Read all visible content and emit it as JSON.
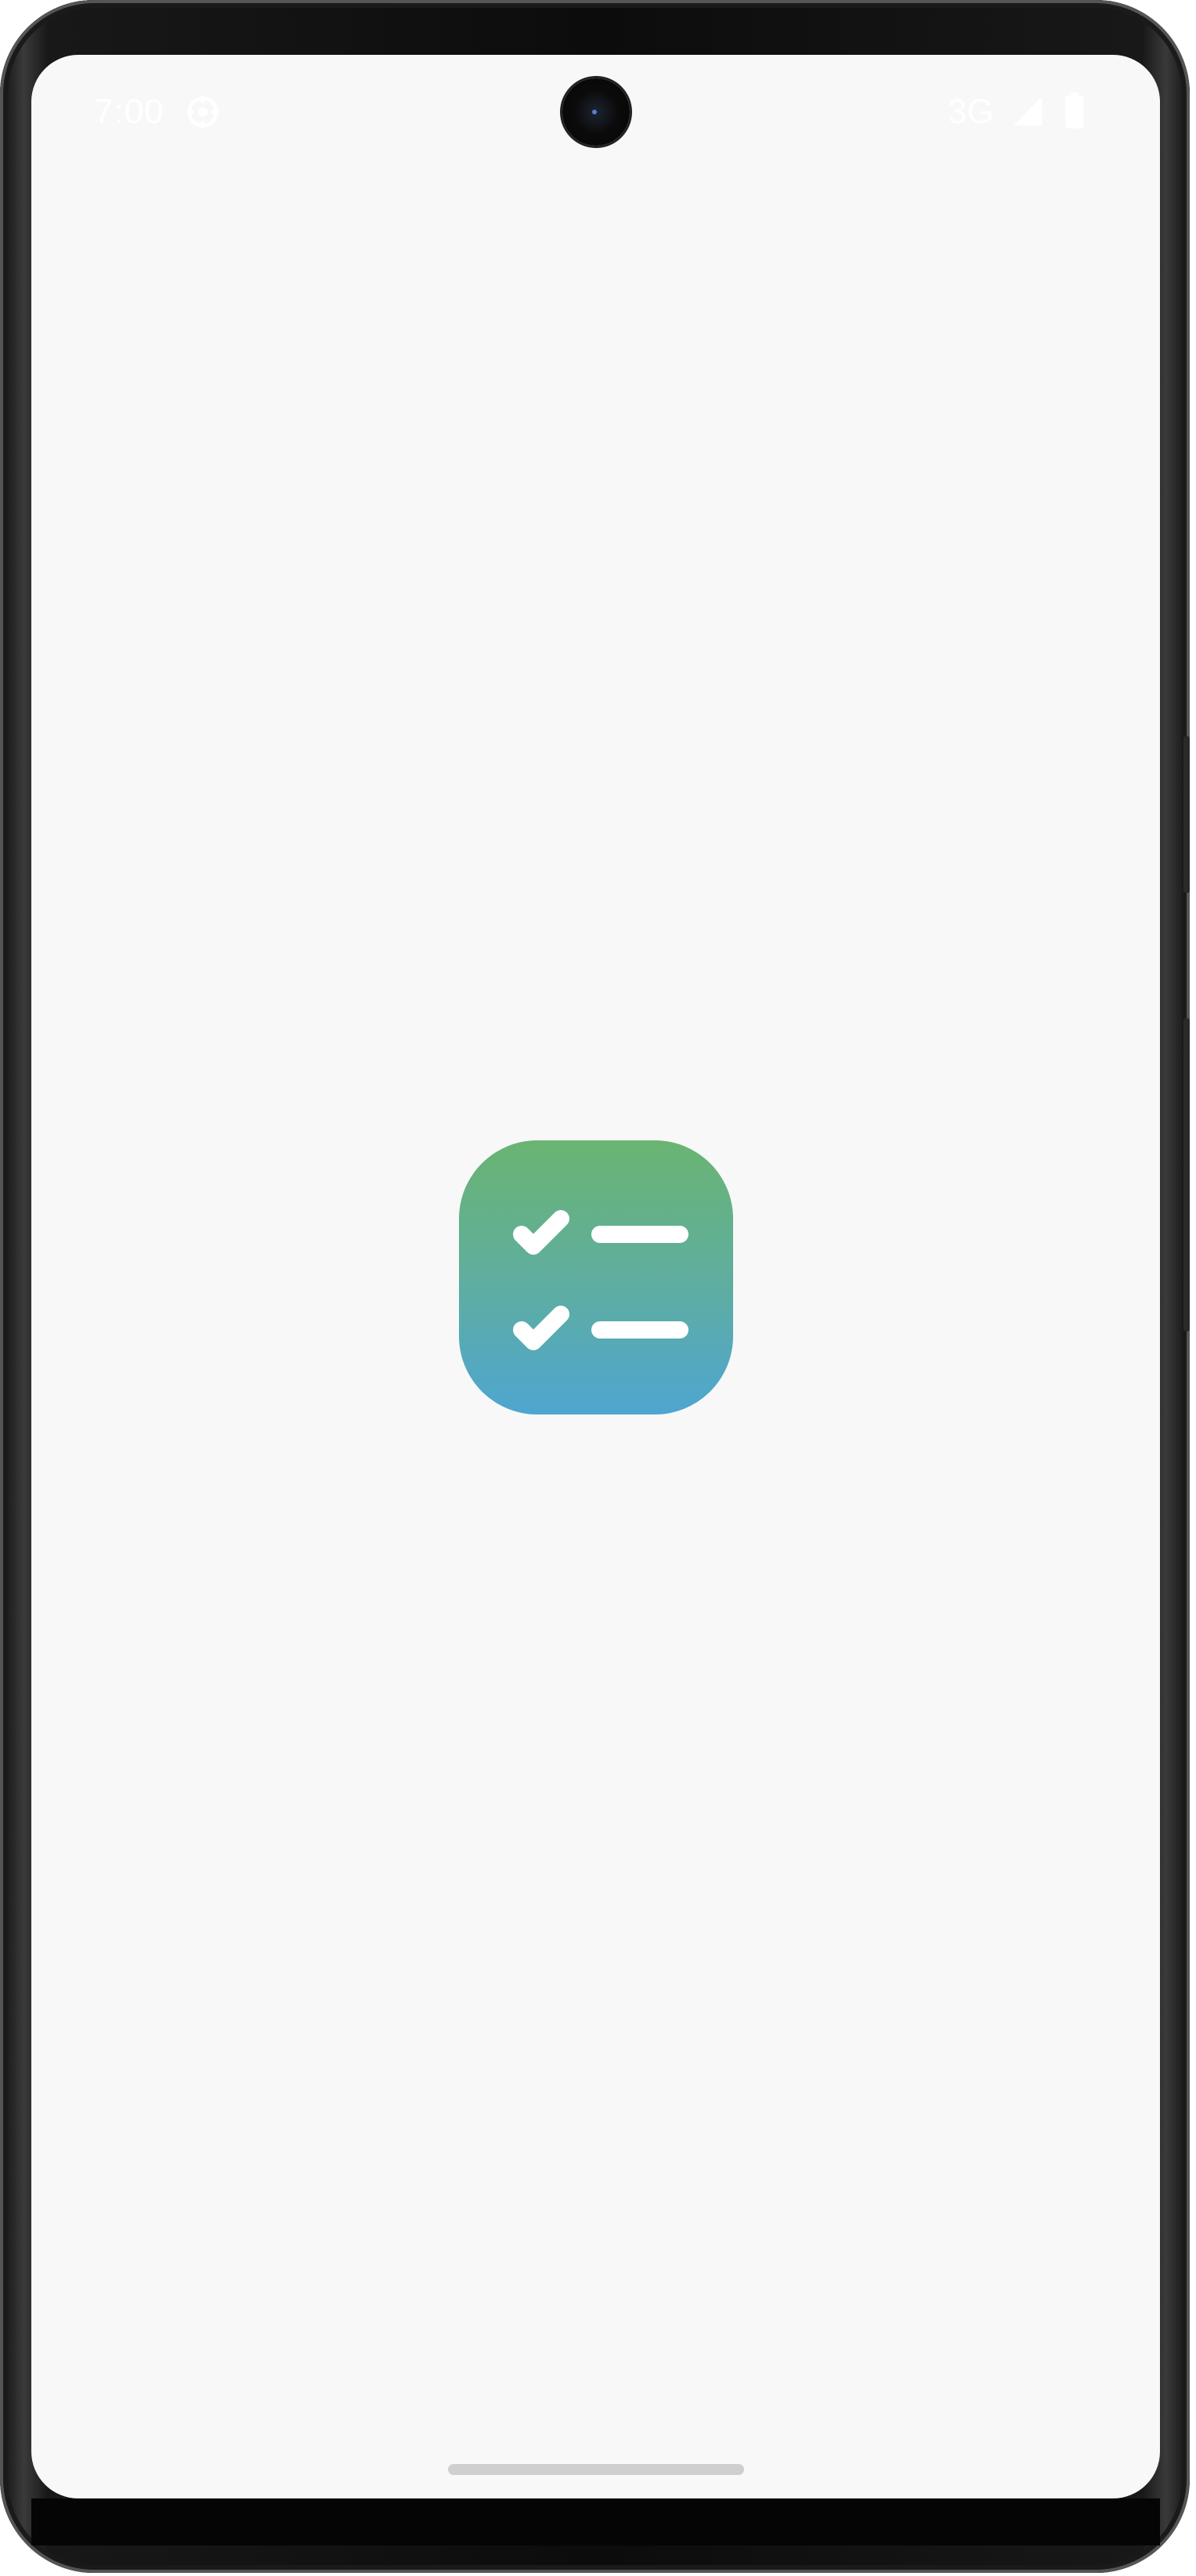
{
  "status_bar": {
    "time": "7:00",
    "network": "3G",
    "icons": [
      "gear-icon",
      "signal-icon",
      "battery-icon"
    ]
  },
  "splash": {
    "icon": "checklist-icon",
    "colors": {
      "gradient_top": "#6ab472",
      "gradient_bottom": "#4ea6d0",
      "glyph": "#ffffff"
    }
  },
  "background_color": "#f8f8f8"
}
